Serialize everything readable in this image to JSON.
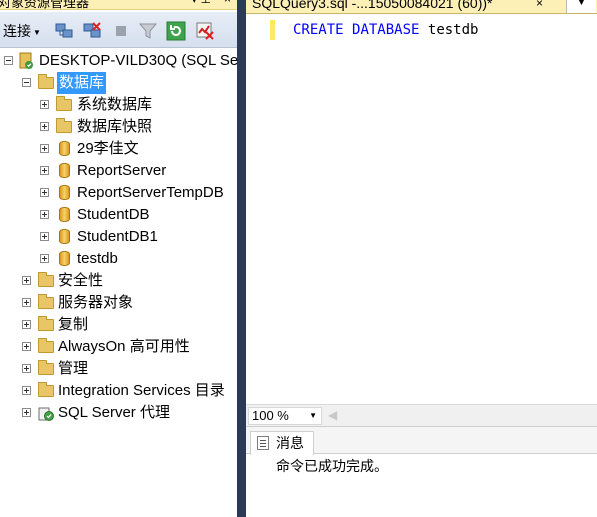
{
  "explorer": {
    "title": "对象资源管理器",
    "pin_glyph": "▾ ᵖ",
    "close_glyph": "×",
    "toolbar": {
      "connect_label": "连接"
    },
    "root": {
      "label": "DESKTOP-VILD30Q (SQL Se"
    },
    "databases_folder": {
      "label": "数据库"
    },
    "database_children": [
      {
        "label": "系统数据库"
      },
      {
        "label": "数据库快照"
      },
      {
        "label": "29李佳文"
      },
      {
        "label": "ReportServer"
      },
      {
        "label": "ReportServerTempDB"
      },
      {
        "label": "StudentDB"
      },
      {
        "label": "StudentDB1"
      },
      {
        "label": "testdb"
      }
    ],
    "server_folders": [
      {
        "label": "安全性"
      },
      {
        "label": "服务器对象"
      },
      {
        "label": "复制"
      },
      {
        "label": "AlwaysOn 高可用性"
      },
      {
        "label": "管理"
      },
      {
        "label": "Integration Services 目录"
      },
      {
        "label": "SQL Server 代理"
      }
    ]
  },
  "editor": {
    "tab_title": "SQLQuery3.sql -...15050084021 (60))*",
    "tab_close": "×",
    "code": {
      "kw1": "CREATE",
      "kw2": "DATABASE",
      "ident": "testdb"
    },
    "zoom": "100 %"
  },
  "results": {
    "tab_label": "消息",
    "message": "命令已成功完成。"
  }
}
